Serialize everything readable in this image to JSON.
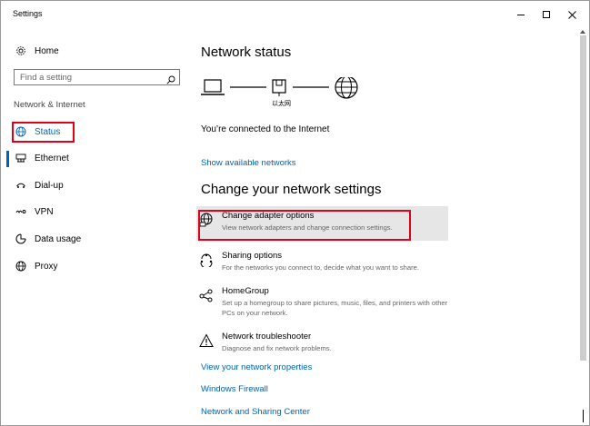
{
  "window": {
    "title": "Settings"
  },
  "sidebar": {
    "home_label": "Home",
    "search_placeholder": "Find a setting",
    "section_label": "Network & Internet",
    "items": [
      {
        "label": "Status",
        "icon": "globe-icon",
        "active": true
      },
      {
        "label": "Ethernet",
        "icon": "ethernet-icon"
      },
      {
        "label": "Dial-up",
        "icon": "dialup-icon"
      },
      {
        "label": "VPN",
        "icon": "vpn-icon"
      },
      {
        "label": "Data usage",
        "icon": "data-usage-icon"
      },
      {
        "label": "Proxy",
        "icon": "globe-icon"
      }
    ]
  },
  "main": {
    "network_status_title": "Network status",
    "network_label": "以太网",
    "connected_text": "You’re connected to the Internet",
    "show_networks_link": "Show available networks",
    "change_settings_title": "Change your network settings",
    "options": [
      {
        "title": "Change adapter options",
        "desc": "View network adapters and change connection settings.",
        "icon": "adapter-globe-icon"
      },
      {
        "title": "Sharing options",
        "desc": "For the networks you connect to, decide what you want to share.",
        "icon": "sharing-icon"
      },
      {
        "title": "HomeGroup",
        "desc": "Set up a homegroup to share pictures, music, files, and printers with other PCs on your network.",
        "icon": "homegroup-icon"
      },
      {
        "title": "Network troubleshooter",
        "desc": "Diagnose and fix network problems.",
        "icon": "warning-icon"
      }
    ],
    "links": {
      "view_properties": "View your network properties",
      "firewall": "Windows Firewall",
      "sharing_center": "Network and Sharing Center"
    }
  },
  "colors": {
    "accent": "#0063b1",
    "highlight_box": "#e1001a",
    "selected_option_bg": "#e6e6e6"
  }
}
